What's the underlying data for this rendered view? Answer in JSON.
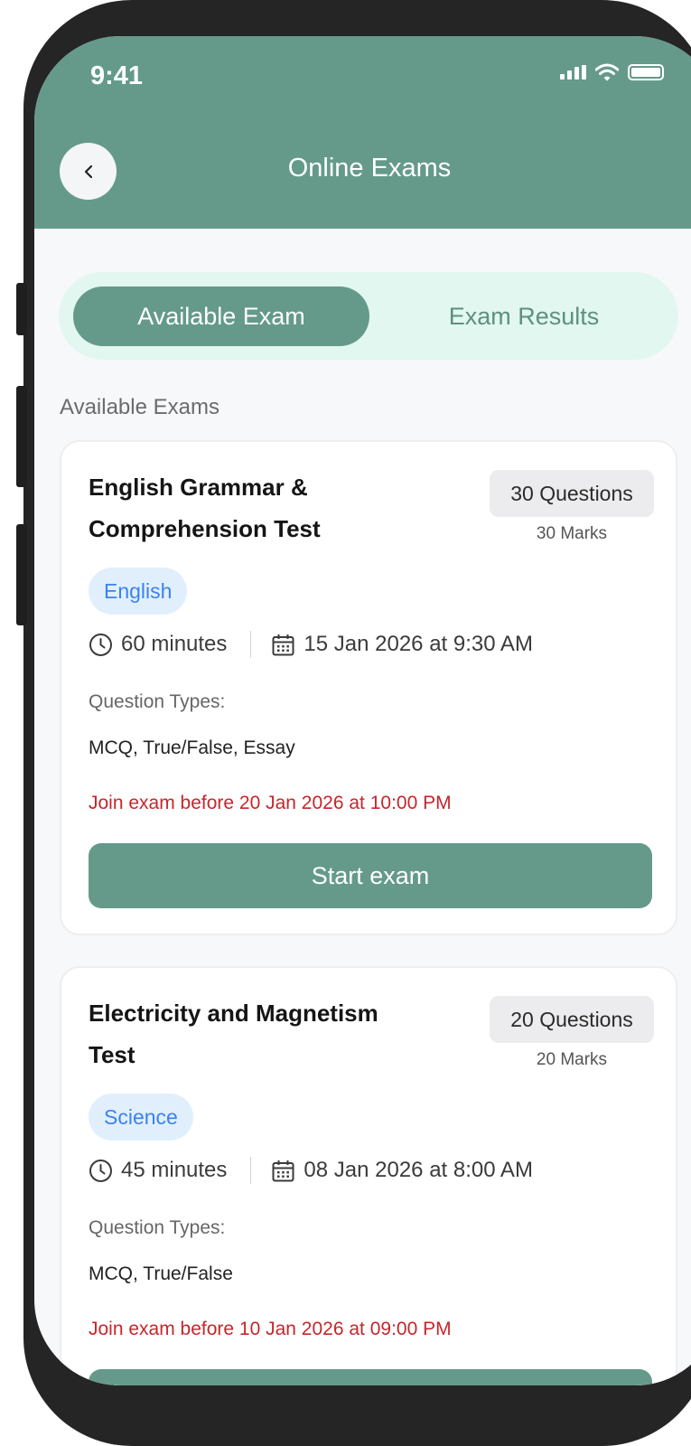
{
  "status_bar": {
    "time": "9:41",
    "icons": [
      "signal-icon",
      "wifi-icon",
      "battery-icon"
    ]
  },
  "header": {
    "title": "Online Exams",
    "back_icon": "chevron-left-icon"
  },
  "tabs": [
    {
      "label": "Available Exam",
      "active": true
    },
    {
      "label": "Exam Results",
      "active": false
    }
  ],
  "section_title": "Available Exams",
  "exams": [
    {
      "title": "English Grammar & Comprehension Test",
      "questions": "30 Questions",
      "marks": "30 Marks",
      "subject": "English",
      "duration": "60 minutes",
      "date": "15 Jan 2026 at 9:30 AM",
      "question_types_label": "Question Types:",
      "question_types": "MCQ, True/False, Essay",
      "deadline": "Join exam before 20 Jan 2026 at 10:00 PM",
      "button_label": "Start exam"
    },
    {
      "title": "Electricity and Magnetism Test",
      "questions": "20 Questions",
      "marks": "20 Marks",
      "subject": "Science",
      "duration": "45 minutes",
      "date": "08 Jan 2026 at 8:00 AM",
      "question_types_label": "Question Types:",
      "question_types": "MCQ, True/False",
      "deadline": "Join exam before 10 Jan 2026 at 09:00 PM",
      "button_label": ""
    }
  ],
  "colors": {
    "primary": "#659a8a",
    "tab_track": "#e2f7ef",
    "subject_badge_bg": "#e1effd",
    "subject_badge_text": "#3b82f0",
    "deadline_text": "#c8252b"
  }
}
